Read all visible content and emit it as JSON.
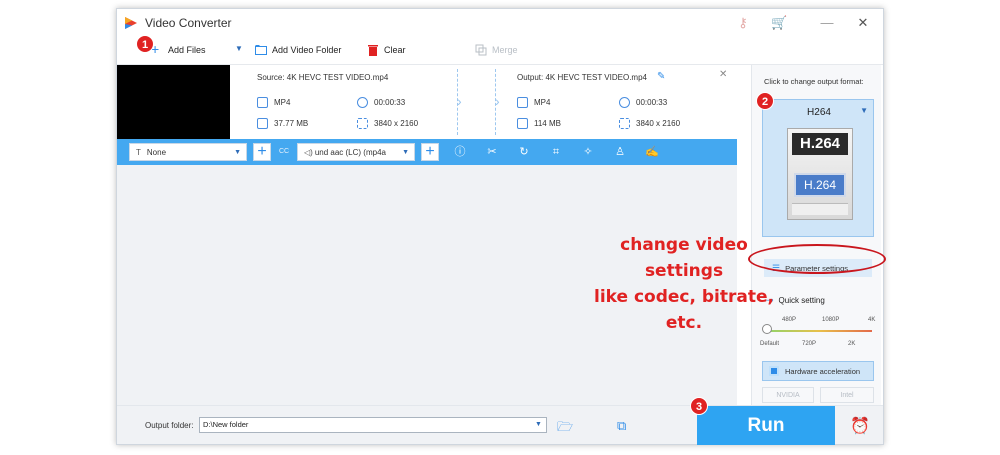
{
  "window": {
    "title": "Video Converter"
  },
  "toolbar": {
    "add_files": "Add Files",
    "add_video_folder": "Add Video Folder",
    "clear": "Clear",
    "merge": "Merge"
  },
  "steps": {
    "one": "1",
    "two": "2",
    "three": "3"
  },
  "file": {
    "source": "Source: 4K HEVC TEST VIDEO.mp4",
    "output": "Output: 4K HEVC TEST VIDEO.mp4",
    "src_format": "MP4",
    "src_duration": "00:00:33",
    "src_size": "37.77 MB",
    "src_resolution": "3840 x 2160",
    "out_format": "MP4",
    "out_duration": "00:00:33",
    "out_size": "114 MB",
    "out_resolution": "3840 x 2160"
  },
  "editbar": {
    "subtitle_select": "None",
    "audio_select": "und aac (LC) (mp4a",
    "cc_label": "CC"
  },
  "right": {
    "hint": "Click to change output format:",
    "format_name": "H264",
    "card_top": "H.264",
    "card_mid": "H.264",
    "parameter_settings": "Parameter settings",
    "quick_setting": "Quick setting",
    "ticks_top": [
      "480P",
      "1080P",
      "4K"
    ],
    "ticks_bottom": [
      "Default",
      "720P",
      "2K"
    ],
    "hardware_acceleration": "Hardware acceleration",
    "nvidia": "NVIDIA",
    "intel": "Intel"
  },
  "bottom": {
    "output_folder_label": "Output folder:",
    "output_folder_value": "D:\\New folder",
    "run": "Run"
  },
  "annotation": {
    "line1": "change video settings",
    "line2": "like codec, bitrate,",
    "line3": "etc."
  },
  "colors": {
    "accent": "#2ea4f2",
    "annotation": "#e02222"
  }
}
